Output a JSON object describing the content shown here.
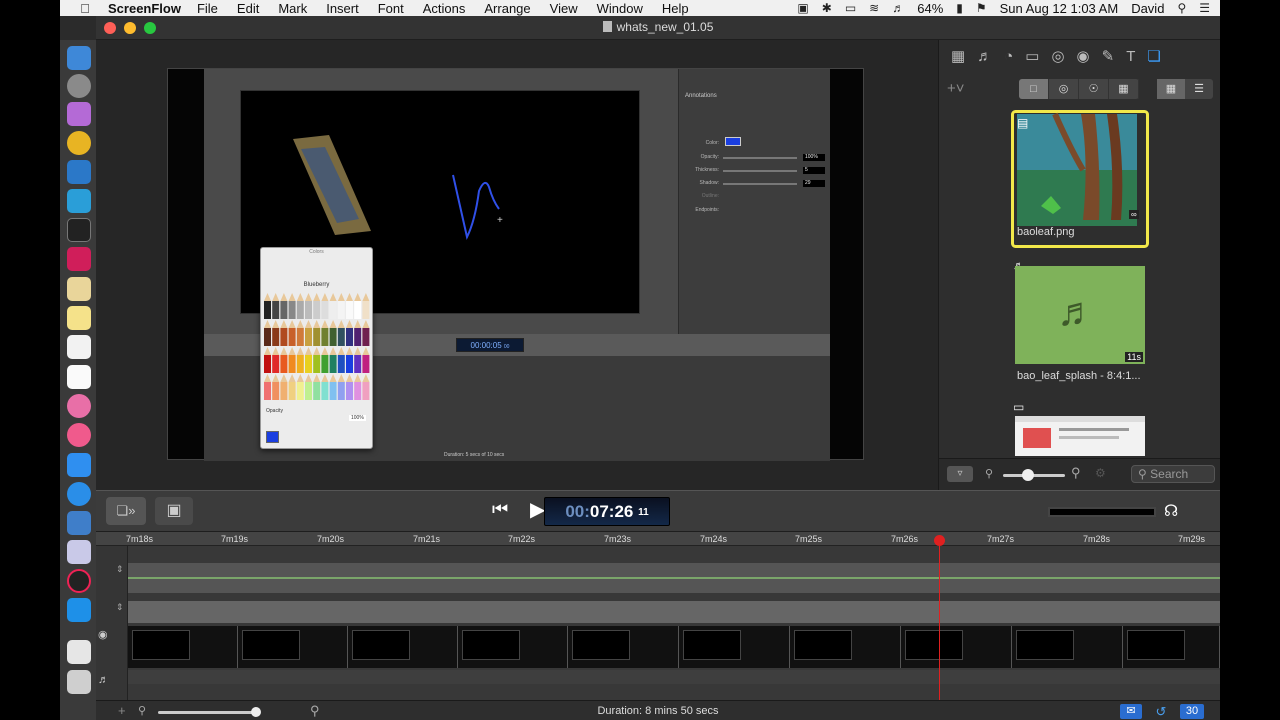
{
  "menubar": {
    "app_name": "ScreenFlow",
    "menus": [
      "File",
      "Edit",
      "Mark",
      "Insert",
      "Font",
      "Actions",
      "Arrange",
      "View",
      "Window",
      "Help"
    ],
    "battery": "64%",
    "datetime": "Sun Aug 12  1:03 AM",
    "user": "David"
  },
  "window": {
    "title": "whats_new_01.05"
  },
  "preview": {
    "inner_props_title": "Annotations",
    "inner_labels": [
      "Color:",
      "Opacity:",
      "Thickness:",
      "Shadow:",
      "Outline:",
      "Endpoints:"
    ],
    "inner_values": [
      "100%",
      "5",
      "29"
    ],
    "inner_timecode": "00:00:05",
    "inner_timecode_frames": "00",
    "inner_duration": "Duration: 5 secs of 10 secs",
    "inner_ticks": [
      "0s",
      "20s",
      "30s",
      "40s",
      "50s",
      "1m",
      "1m10s",
      "1m20s",
      "1m30s",
      "1m40s"
    ]
  },
  "colors_panel": {
    "title": "Colors",
    "color_name": "Blueberry",
    "opacity_label": "Opacity",
    "opacity_value": "100%"
  },
  "library": {
    "items": [
      {
        "name": "baoleaf.png",
        "selected": true,
        "kind": "image"
      },
      {
        "name": "bao_leaf_splash - 8:4:1...",
        "selected": false,
        "kind": "audio",
        "duration": "11s"
      },
      {
        "name": "",
        "selected": false,
        "kind": "screen"
      }
    ],
    "search_placeholder": "Search"
  },
  "transport": {
    "timecode_hours": "00:",
    "timecode_main": "07:26",
    "timecode_frames": "11"
  },
  "timeline": {
    "ticks": [
      "7m18s",
      "7m19s",
      "7m20s",
      "7m21s",
      "7m22s",
      "7m23s",
      "7m24s",
      "7m25s",
      "7m26s",
      "7m27s",
      "7m28s",
      "7m29s"
    ]
  },
  "statusbar": {
    "duration": "Duration: 8 mins 50 secs",
    "badge_count": "30"
  },
  "colors": {
    "accent": "#3b9dfa",
    "selection": "#f2e84a",
    "playhead": "#e02020",
    "audio_clip": "#7fb25a"
  }
}
